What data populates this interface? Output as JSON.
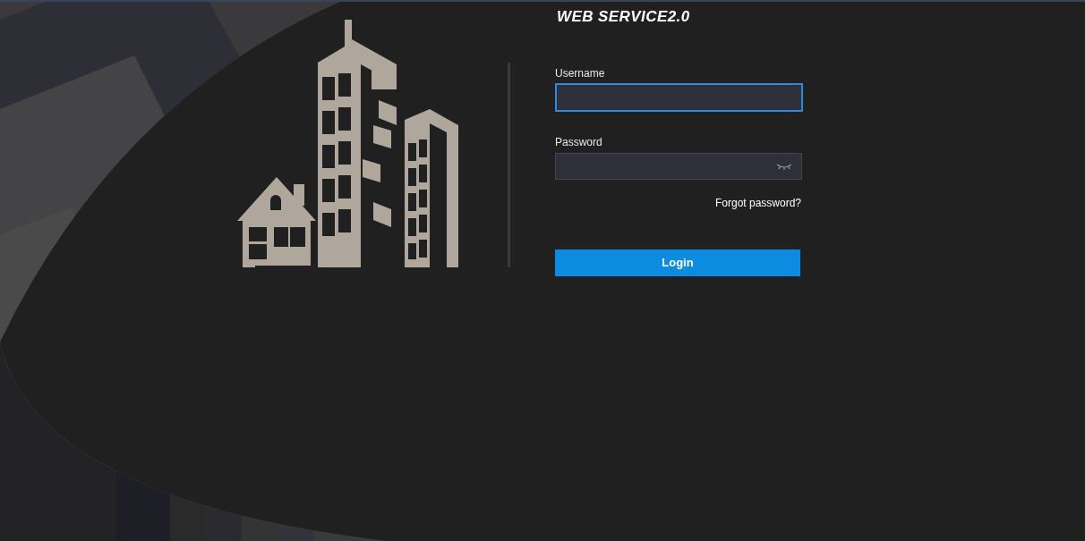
{
  "title": "WEB SERVICE2.0",
  "username": {
    "label": "Username",
    "focused": true
  },
  "password": {
    "label": "Password",
    "focused": false
  },
  "forgot_link": "Forgot password?",
  "login_button": "Login"
}
